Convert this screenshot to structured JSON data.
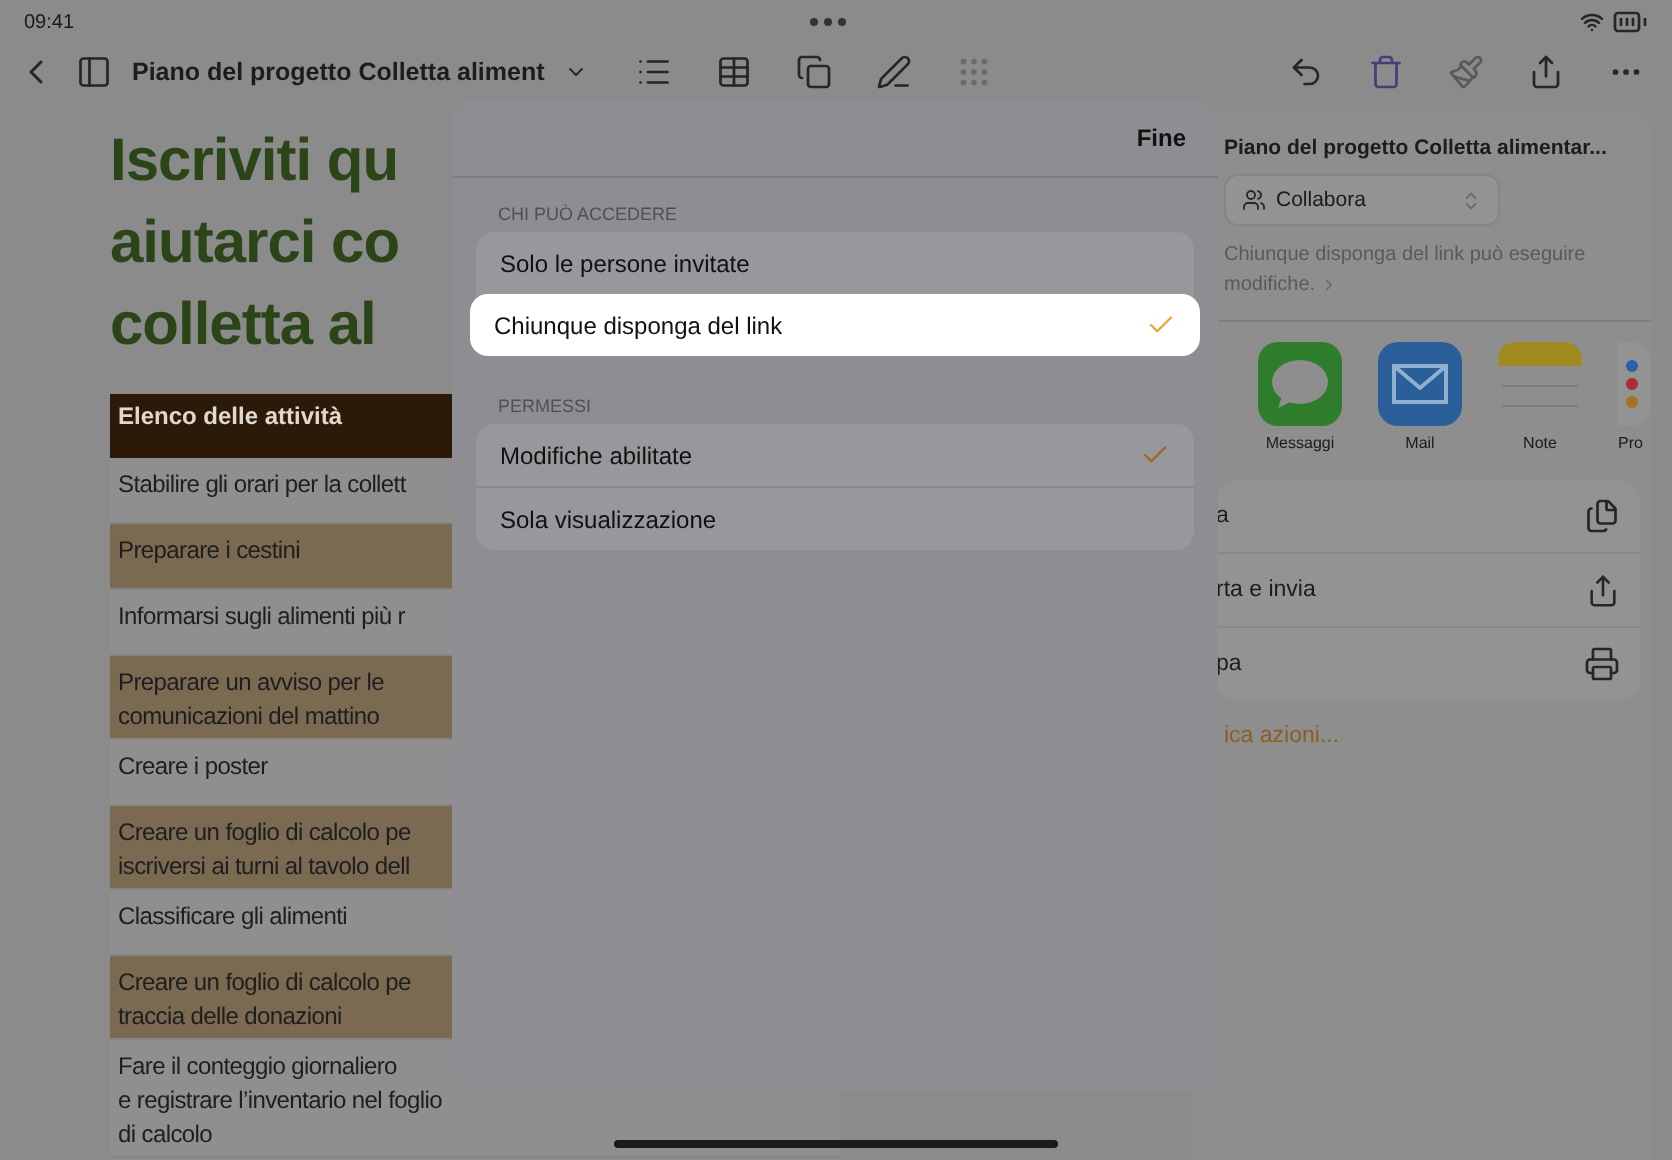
{
  "status_bar": {
    "time": "09:41"
  },
  "toolbar": {
    "title": "Piano del progetto Colletta aliment"
  },
  "document": {
    "heading_lines": [
      "Iscriviti qu",
      "aiutarci co",
      "colletta al"
    ],
    "table": {
      "header": "Elenco delle attività",
      "rows": [
        {
          "lines": [
            "Stabilire gli orari per la collett"
          ],
          "shaded": false
        },
        {
          "lines": [
            "Preparare i cestini"
          ],
          "shaded": true
        },
        {
          "lines": [
            "Informarsi sugli alimenti più r"
          ],
          "shaded": false
        },
        {
          "lines": [
            "Preparare un avviso per le",
            "comunicazioni del mattino"
          ],
          "shaded": true
        },
        {
          "lines": [
            "Creare i poster"
          ],
          "shaded": false
        },
        {
          "lines": [
            "Creare un foglio di calcolo pe",
            "iscriversi ai turni al tavolo dell"
          ],
          "shaded": true
        },
        {
          "lines": [
            "Classificare gli alimenti"
          ],
          "shaded": false
        },
        {
          "lines": [
            "Creare un foglio di calcolo pe",
            "traccia delle donazioni"
          ],
          "shaded": true
        },
        {
          "lines": [
            "Fare il conteggio giornaliero",
            "e registrare l’inventario nel foglio",
            "di calcolo"
          ],
          "shaded": false
        }
      ]
    }
  },
  "share_sheet": {
    "title": "Piano del progetto Colletta alimentar...",
    "mode": "Collabora",
    "note": "Chiunque disponga del link può eseguire modifiche.",
    "apps": [
      {
        "label": "Messaggi",
        "kind": "messages"
      },
      {
        "label": "Mail",
        "kind": "mail"
      },
      {
        "label": "Note",
        "kind": "notes"
      },
      {
        "label": "Pro",
        "kind": "reminders"
      }
    ],
    "actions": [
      {
        "label": "a",
        "kind": "copy"
      },
      {
        "label": "rta e invia",
        "kind": "export"
      },
      {
        "label": "pa",
        "kind": "print"
      }
    ],
    "edit_actions": "ica azioni..."
  },
  "access_sheet": {
    "done": "Fine",
    "sections": [
      {
        "title": "CHI PUÒ ACCEDERE",
        "options": [
          {
            "label": "Solo le persone invitate",
            "selected": false,
            "checked": false
          },
          {
            "label": "Chiunque disponga del link",
            "selected": true,
            "checked": true
          }
        ]
      },
      {
        "title": "PERMESSI",
        "options": [
          {
            "label": "Modifiche abilitate",
            "selected": false,
            "checked": true
          },
          {
            "label": "Sola visualizzazione",
            "selected": false,
            "checked": false
          }
        ]
      }
    ]
  }
}
